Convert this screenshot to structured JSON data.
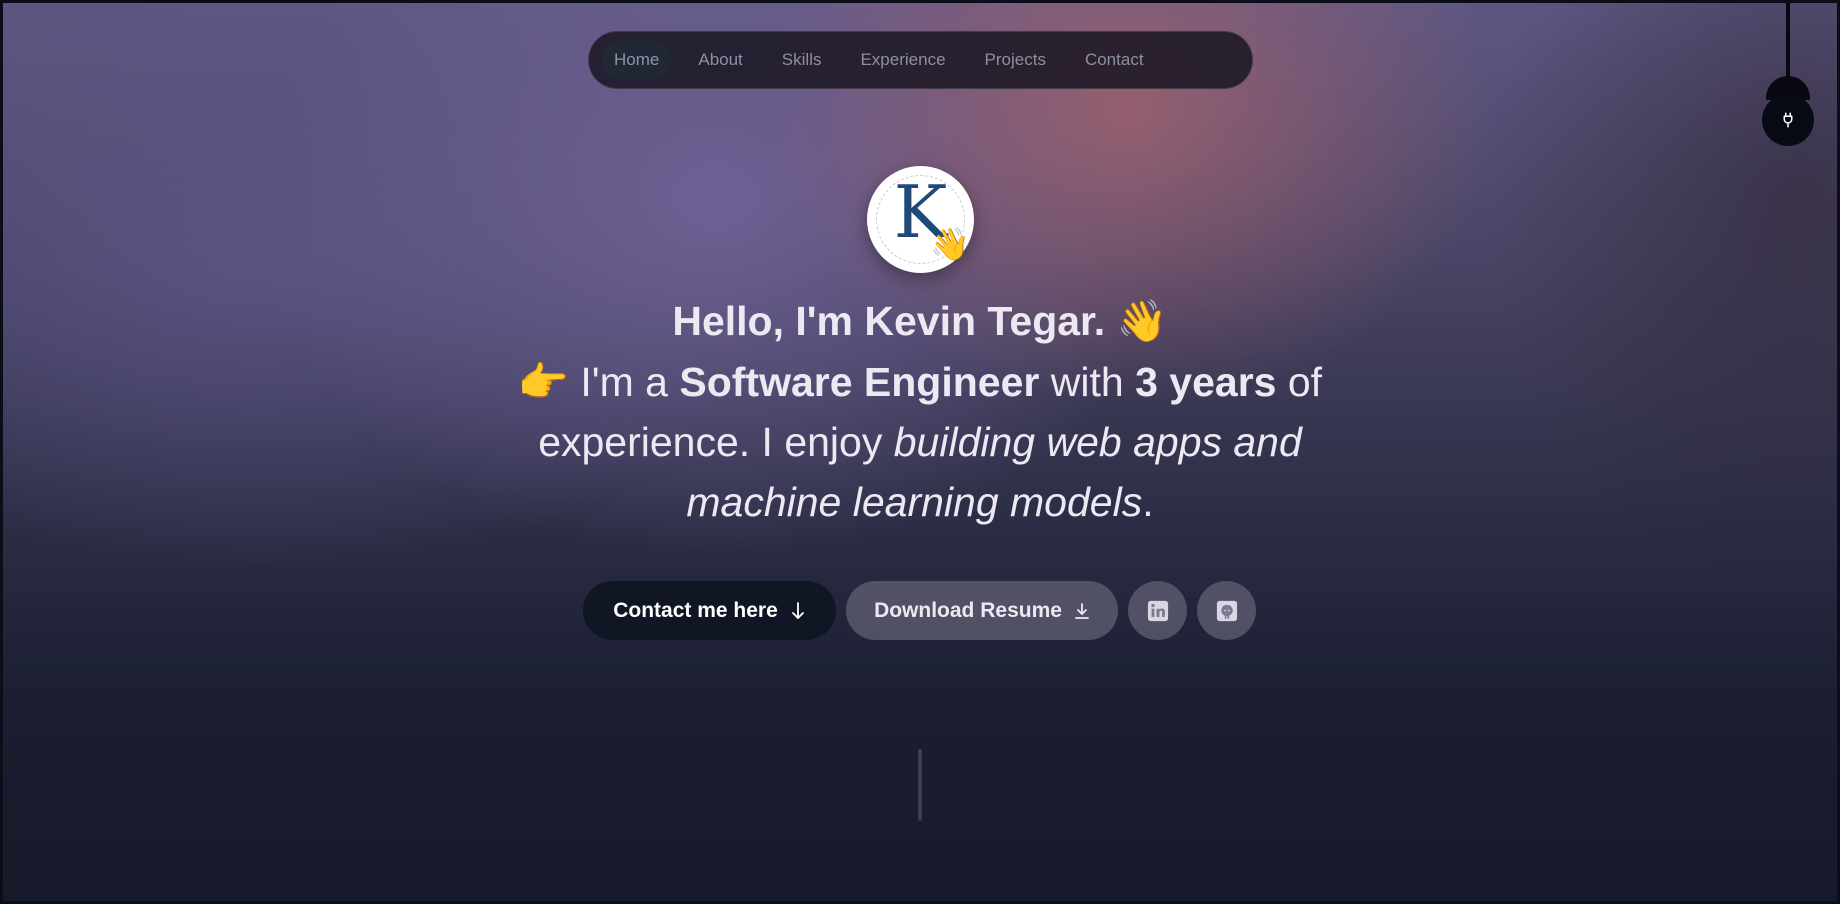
{
  "nav": {
    "items": [
      {
        "label": "Home",
        "active": true
      },
      {
        "label": "About"
      },
      {
        "label": "Skills"
      },
      {
        "label": "Experience"
      },
      {
        "label": "Projects"
      },
      {
        "label": "Contact"
      }
    ]
  },
  "theme_toggle": {
    "icon": "lightbulb-icon"
  },
  "avatar": {
    "letter": "K",
    "emoji": "👋"
  },
  "hero": {
    "greeting": "Hello, I'm Kevin Tegar.",
    "greeting_emoji": "👋",
    "pointer_emoji": "👉",
    "intro_prefix": "I'm a",
    "role": "Software Engineer",
    "with_text": "with",
    "years": "3 years",
    "of_text": "of experience. I enjoy",
    "enjoy_text": "building web apps and machine learning models",
    "end": "."
  },
  "actions": {
    "contact_label": "Contact me here",
    "resume_label": "Download Resume",
    "linkedin_icon": "linkedin-icon",
    "github_icon": "github-icon"
  },
  "colors": {
    "accent_dark": "#111624",
    "avatar_letter": "#1f4a78",
    "text": "#ece9f3"
  }
}
